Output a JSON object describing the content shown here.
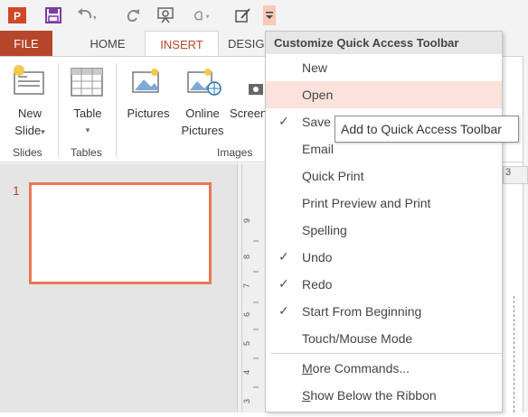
{
  "quick_access": {
    "icons": [
      "powerpoint-logo-icon",
      "save-icon",
      "undo-icon",
      "redo-icon",
      "start-from-beginning-icon",
      "touch-mouse-mode-icon",
      "customize-icon",
      "dropdown-arrow-icon"
    ]
  },
  "tabs": {
    "file": "FILE",
    "home": "HOME",
    "insert": "INSERT",
    "design": "DESIG"
  },
  "ribbon": {
    "new_slide": "New",
    "new_slide_2": "Slide",
    "table": "Table",
    "pictures": "Pictures",
    "online_pictures_1": "Online",
    "online_pictures_2": "Pictures",
    "screenshot": "Screen",
    "groups": {
      "slides": "Slides",
      "tables": "Tables",
      "images": "Images"
    }
  },
  "slide_panel": {
    "slide_number": "1"
  },
  "ruler_right": "3",
  "menu": {
    "header": "Customize Quick Access Toolbar",
    "items": [
      {
        "label": "New",
        "checked": false
      },
      {
        "label": "Open",
        "checked": false
      },
      {
        "label": "Save",
        "checked": true
      },
      {
        "label": "Email",
        "checked": false
      },
      {
        "label": "Quick Print",
        "checked": false
      },
      {
        "label": "Print Preview and Print",
        "checked": false
      },
      {
        "label": "Spelling",
        "checked": false
      },
      {
        "label": "Undo",
        "checked": true
      },
      {
        "label": "Redo",
        "checked": true
      },
      {
        "label": "Start From Beginning",
        "checked": true
      },
      {
        "label": "Touch/Mouse Mode",
        "checked": false
      }
    ],
    "more_commands_u": "M",
    "more_commands_rest": "ore Commands...",
    "show_below_u": "S",
    "show_below_rest": "how Below the Ribbon",
    "check_glyph": "✓"
  },
  "tooltip": "Add to Quick Access Toolbar",
  "colors": {
    "accent": "#b7472a",
    "hover": "#fbe3dc"
  }
}
